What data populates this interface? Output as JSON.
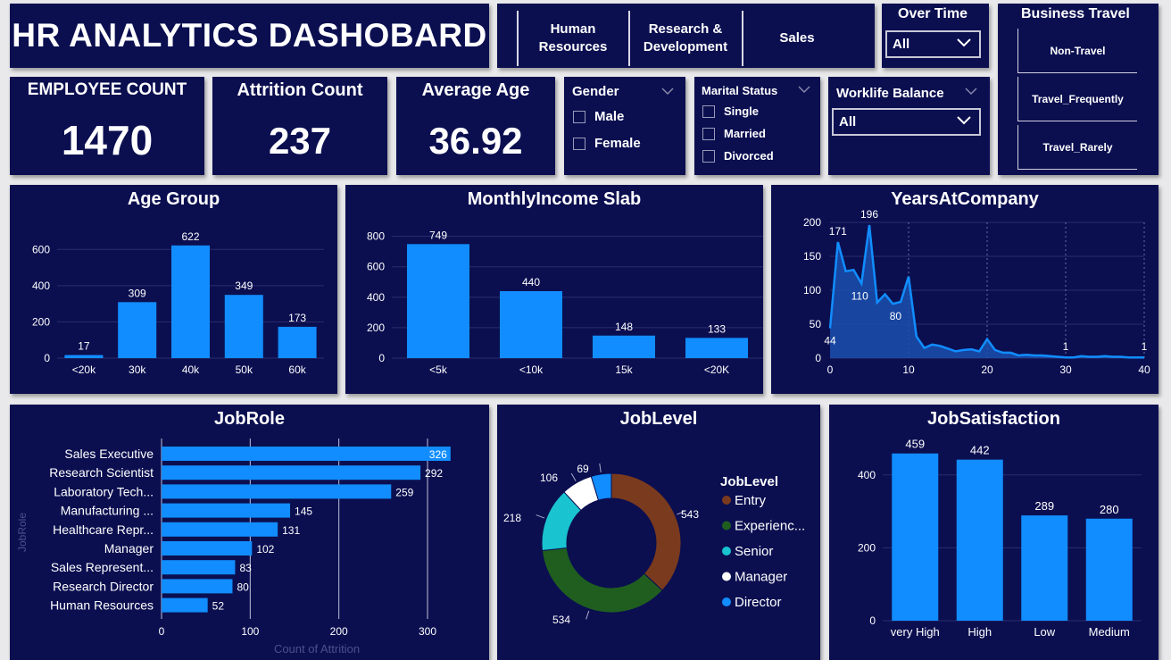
{
  "header": {
    "title": "HR ANALYTICS DASHOBARD"
  },
  "department_slicer": {
    "items": [
      "Human\nResources",
      "Research &\nDevelopment",
      "Sales"
    ]
  },
  "over_time": {
    "label": "Over Time",
    "value": "All"
  },
  "business_travel": {
    "label": "Business Travel",
    "items": [
      "Non-Travel",
      "Travel_Frequently",
      "Travel_Rarely"
    ]
  },
  "kpis": {
    "employee_count": {
      "label": "EMPLOYEE COUNT",
      "value": "1470"
    },
    "attrition_count": {
      "label": "Attrition Count",
      "value": "237"
    },
    "average_age": {
      "label": "Average Age",
      "value": "36.92"
    }
  },
  "gender": {
    "label": "Gender",
    "options": [
      "Male",
      "Female"
    ]
  },
  "marital_status": {
    "label": "Marital Status",
    "options": [
      "Single",
      "Married",
      "Divorced"
    ]
  },
  "worklife_balance": {
    "label": "Worklife Balance",
    "value": "All"
  },
  "colors": {
    "panel": "#0b0f50",
    "bar": "#118dff",
    "axis_text": "#ffffff"
  },
  "chart_data": [
    {
      "id": "age_group",
      "type": "bar",
      "title": "Age Group",
      "categories": [
        "<20k",
        "30k",
        "40k",
        "50k",
        "60k"
      ],
      "values": [
        17,
        309,
        622,
        349,
        173
      ],
      "ylim": [
        0,
        700
      ],
      "yticks": [
        0,
        200,
        400,
        600
      ]
    },
    {
      "id": "monthly_income",
      "type": "bar",
      "title": "MonthlyIncome Slab",
      "categories": [
        "<5k",
        "<10k",
        "15k",
        "<20K"
      ],
      "values": [
        749,
        440,
        148,
        133
      ],
      "ylim": [
        0,
        880
      ],
      "yticks": [
        0,
        200,
        400,
        600,
        800
      ]
    },
    {
      "id": "years_at_company",
      "type": "area",
      "title": "YearsAtCompany",
      "x": [
        0,
        1,
        2,
        3,
        4,
        5,
        6,
        7,
        8,
        9,
        10,
        11,
        12,
        13,
        14,
        15,
        16,
        17,
        18,
        19,
        20,
        21,
        22,
        23,
        24,
        25,
        26,
        27,
        28,
        29,
        30,
        31,
        32,
        33,
        34,
        35,
        36,
        37,
        38,
        39,
        40
      ],
      "values": [
        44,
        171,
        128,
        130,
        110,
        196,
        82,
        94,
        80,
        83,
        120,
        32,
        15,
        20,
        18,
        14,
        10,
        12,
        13,
        10,
        28,
        12,
        8,
        8,
        4,
        5,
        4,
        4,
        3,
        2,
        1,
        1,
        3,
        2,
        2,
        3,
        2,
        2,
        1,
        1,
        1
      ],
      "point_labels": [
        {
          "x": 0,
          "label": "44"
        },
        {
          "x": 1,
          "label": "171"
        },
        {
          "x": 4,
          "label": "110"
        },
        {
          "x": 5,
          "label": "196"
        },
        {
          "x": 8,
          "label": "80"
        },
        {
          "x": 30,
          "label": "1"
        },
        {
          "x": 40,
          "label": "1"
        }
      ],
      "xticks": [
        0,
        10,
        20,
        30,
        40
      ],
      "yticks": [
        0,
        50,
        100,
        150,
        200
      ],
      "ylim": [
        0,
        200
      ],
      "xlim": [
        0,
        40
      ]
    },
    {
      "id": "job_role",
      "type": "bar",
      "orientation": "horizontal",
      "title": "JobRole",
      "ylabel": "JobRole",
      "xlabel": "Count of Attrition",
      "categories": [
        "Sales Executive",
        "Research Scientist",
        "Laboratory Tech...",
        "Manufacturing ...",
        "Healthcare Repr...",
        "Manager",
        "Sales Represent...",
        "Research Director",
        "Human Resources"
      ],
      "values": [
        326,
        292,
        259,
        145,
        131,
        102,
        83,
        80,
        52
      ],
      "xlim": [
        0,
        330
      ],
      "xticks": [
        0,
        100,
        200,
        300
      ]
    },
    {
      "id": "job_level",
      "type": "pie",
      "title": "JobLevel",
      "legend_title": "JobLevel",
      "categories": [
        "Entry",
        "Experienc...",
        "Senior",
        "Manager",
        "Director"
      ],
      "values": [
        543,
        534,
        218,
        106,
        69
      ],
      "colors": [
        "#7a3a1e",
        "#1f5e1f",
        "#19c3cf",
        "#ffffff",
        "#118dff"
      ]
    },
    {
      "id": "job_satisfaction",
      "type": "bar",
      "title": "JobSatisfaction",
      "categories": [
        "very High",
        "High",
        "Low",
        "Medium"
      ],
      "values": [
        459,
        442,
        289,
        280
      ],
      "ylim": [
        0,
        500
      ],
      "yticks": [
        0,
        200,
        400
      ]
    }
  ]
}
